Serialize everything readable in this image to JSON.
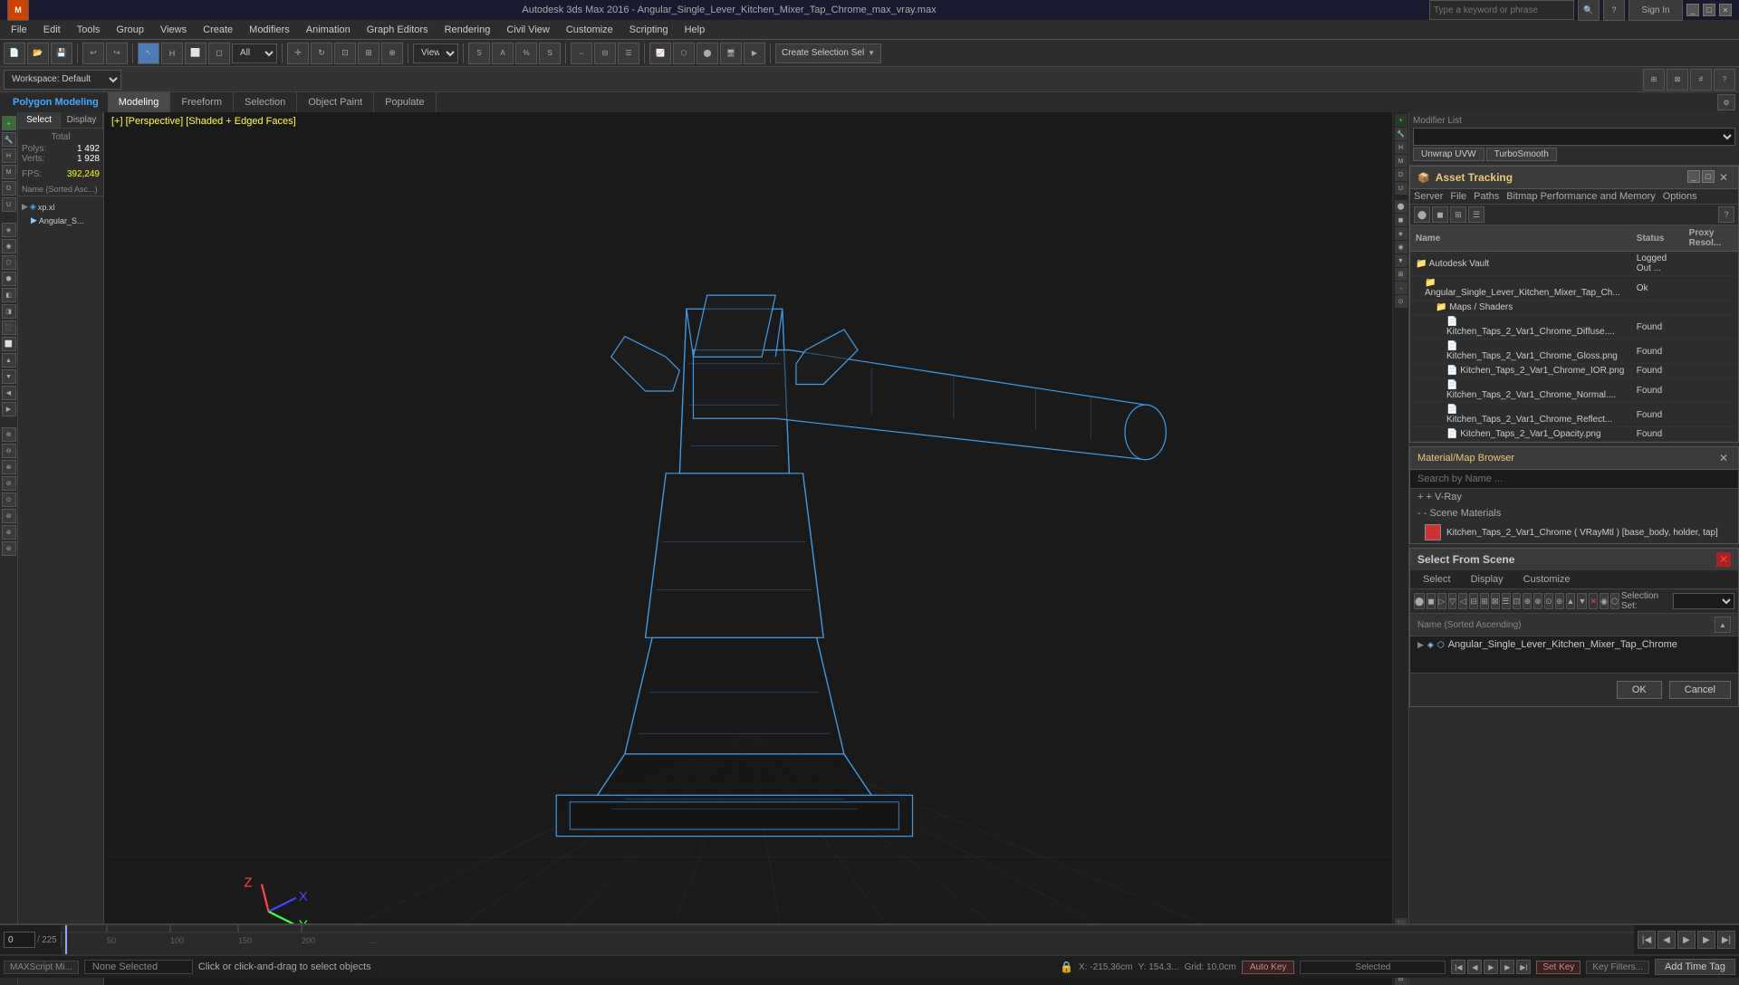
{
  "titleBar": {
    "appName": "3ds Max",
    "title": "Autodesk 3ds Max 2016  -  Angular_Single_Lever_Kitchen_Mixer_Tap_Chrome_max_vray.max",
    "searchPlaceholder": "Type a keyword or phrase",
    "signIn": "Sign In",
    "winButtons": [
      "_",
      "□",
      "×"
    ]
  },
  "menuBar": {
    "items": [
      "File",
      "Edit",
      "Tools",
      "Group",
      "Views",
      "Create",
      "Modifiers",
      "Animation",
      "Graph Editors",
      "Rendering",
      "Civil View",
      "Customize",
      "Scripting",
      "Help"
    ]
  },
  "toolbar2": {
    "workspaceLabel": "Workspace: Default",
    "viewLabel": "View",
    "allLabel": "All",
    "createSelLabel": "Create Selection Sel"
  },
  "polyModelingBar": {
    "appLabel": "Polygon Modeling",
    "tabs": [
      {
        "id": "modeling",
        "label": "Modeling",
        "active": true
      },
      {
        "id": "freeform",
        "label": "Freeform"
      },
      {
        "id": "selection",
        "label": "Selection"
      },
      {
        "id": "objectPaint",
        "label": "Object Paint"
      },
      {
        "id": "populate",
        "label": "Populate"
      }
    ]
  },
  "scenePanel": {
    "tabs": [
      {
        "id": "select",
        "label": "Select",
        "active": true
      },
      {
        "id": "display",
        "label": "Display"
      }
    ],
    "stats": {
      "polysLabel": "Polys:",
      "polysValue": "1 492",
      "vertsLabel": "Verts:",
      "vertsValue": "1 928",
      "fpsLabel": "FPS:",
      "fpsValue": "392,249"
    },
    "sortLabel": "Name (Sorted Asc...)",
    "treeItems": [
      {
        "label": "Angular_S...",
        "level": 0
      }
    ]
  },
  "viewport": {
    "label": "[+] [Perspective] [Shaded + Edged Faces]",
    "modelName": "Angular_Single_Lever_Kitchen_Mixer_Tap_Chrome"
  },
  "assetTracking": {
    "title": "Asset Tracking",
    "menuItems": [
      "Server",
      "File",
      "Paths",
      "Bitmap Performance and Memory",
      "Options"
    ],
    "tableHeaders": [
      "Name",
      "Status",
      "Proxy Resol..."
    ],
    "rows": [
      {
        "name": "Autodesk Vault",
        "status": "Logged Out ...",
        "statusClass": "status-logged-out",
        "indent": 0,
        "icon": "folder"
      },
      {
        "name": "Angular_Single_Lever_Kitchen_Mixer_Tap_Ch...",
        "status": "Ok",
        "statusClass": "status-ok",
        "indent": 1,
        "icon": "folder"
      },
      {
        "name": "Maps / Shaders",
        "status": "",
        "statusClass": "",
        "indent": 2,
        "icon": "folder"
      },
      {
        "name": "Kitchen_Taps_2_Var1_Chrome_Diffuse....",
        "status": "Found",
        "statusClass": "status-found",
        "indent": 3,
        "icon": "file"
      },
      {
        "name": "Kitchen_Taps_2_Var1_Chrome_Gloss.png",
        "status": "Found",
        "statusClass": "status-found",
        "indent": 3,
        "icon": "file"
      },
      {
        "name": "Kitchen_Taps_2_Var1_Chrome_IOR.png",
        "status": "Found",
        "statusClass": "status-found",
        "indent": 3,
        "icon": "file"
      },
      {
        "name": "Kitchen_Taps_2_Var1_Chrome_Normal....",
        "status": "Found",
        "statusClass": "status-found",
        "indent": 3,
        "icon": "file"
      },
      {
        "name": "Kitchen_Taps_2_Var1_Chrome_Reflect...",
        "status": "Found",
        "statusClass": "status-found",
        "indent": 3,
        "icon": "file"
      },
      {
        "name": "Kitchen_Taps_2_Var1_Opacity.png",
        "status": "Found",
        "statusClass": "status-found",
        "indent": 3,
        "icon": "file"
      }
    ]
  },
  "materialBrowser": {
    "title": "Material/Map Browser",
    "searchPlaceholder": "Search by Name ...",
    "sections": [
      {
        "label": "+ V-Ray",
        "expanded": false
      },
      {
        "label": "- Scene Materials",
        "expanded": true
      }
    ],
    "materials": [
      {
        "name": "Kitchen_Taps_2_Var1_Chrome ( VRayMtl ) [base_body, holder, tap]",
        "swatchColor": "#cc3333"
      }
    ]
  },
  "selectFromScene": {
    "title": "Select From Scene",
    "tabs": [
      "Select",
      "Display",
      "Customize"
    ],
    "nameHeader": "Name (Sorted Ascending)",
    "selectionSetLabel": "Selection Set:",
    "selectionSetValue": "",
    "treeItems": [
      {
        "label": "Angular_Single_Lever_Kitchen_Mixer_Tap_Chrome",
        "level": 0
      }
    ],
    "buttons": {
      "ok": "OK",
      "cancel": "Cancel"
    }
  },
  "bottomBar": {
    "noneSelected": "None Selected",
    "statusText": "Click or click-and-drag to select objects",
    "coords": {
      "x": "X: -215,36cm",
      "y": "Y: 154,3...",
      "gridSnap": "Grid: 10,0cm"
    },
    "timelineFrames": "0 / 225",
    "autoKey": "Auto Key",
    "setKey": "Set Key",
    "keyFilters": "Key Filters...",
    "addTimeTag": "Add Time Tag"
  },
  "modifierPanel": {
    "label": "Modifier List",
    "buttons": [
      "Unwrap UVW",
      "TurboSmooth"
    ]
  },
  "icons": {
    "folder": "📁",
    "file": "📄",
    "search": "🔍",
    "close": "✕",
    "expand": "▶",
    "collapse": "▼",
    "light": "💡",
    "camera": "📷",
    "sphere": "⬤",
    "cylinder": "▮",
    "play": "▶",
    "stop": "■",
    "rewind": "◀◀",
    "forward": "▶▶",
    "nextFrame": "▶|",
    "prevFrame": "|◀"
  }
}
